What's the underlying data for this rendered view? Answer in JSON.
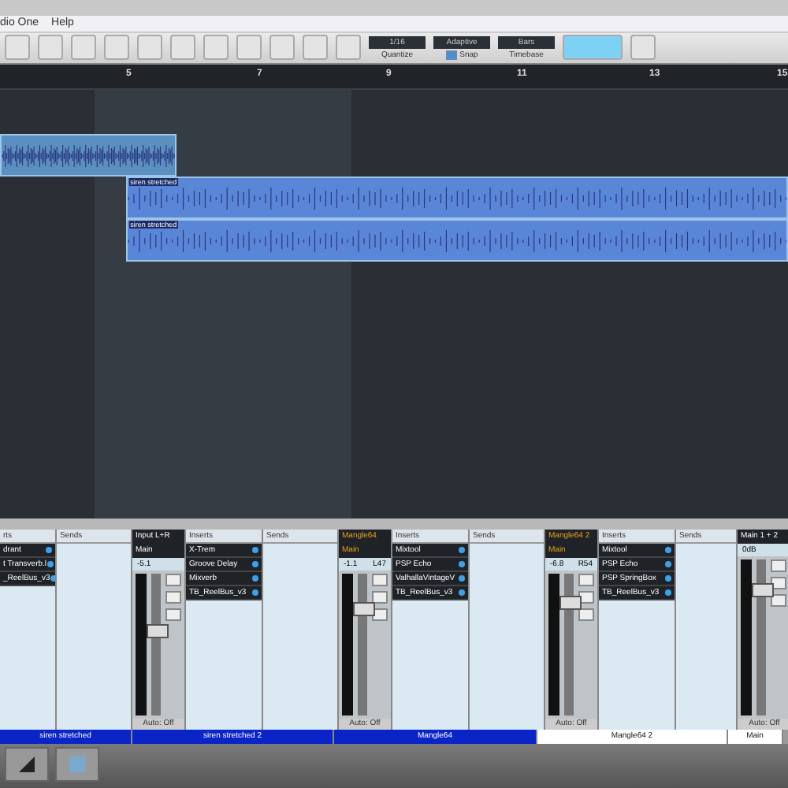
{
  "menu": [
    "dio One",
    "Help"
  ],
  "toolbar": {
    "quantize": {
      "value": "1/16",
      "label": "Quantize"
    },
    "snap": {
      "value": "Adaptive",
      "label": "Snap",
      "checked": true
    },
    "timebase": {
      "value": "Bars",
      "label": "Timebase"
    }
  },
  "ruler": [
    "5",
    "7",
    "9",
    "11",
    "13",
    "15"
  ],
  "clips": [
    {
      "kind": "plain"
    },
    {
      "label": "siren stretched",
      "kind": "blue"
    },
    {
      "label": "siren stretched",
      "kind": "blue"
    }
  ],
  "mixer": [
    {
      "kind": "inserts",
      "title": "rts",
      "items": [
        "drant",
        "t Transverb.l",
        "_ReelBus_v3"
      ]
    },
    {
      "kind": "sends",
      "title": "Sends"
    },
    {
      "kind": "channel",
      "name": "Input L+R",
      "output": "Main",
      "volume": "-5.1",
      "level": 0.55,
      "orange": false,
      "auto": "Auto: Off"
    },
    {
      "kind": "inserts",
      "title": "Inserts",
      "items": [
        "X-Trem",
        "Groove Delay",
        "Mixverb",
        "TB_ReelBus_v3"
      ]
    },
    {
      "kind": "sends",
      "title": "Sends"
    },
    {
      "kind": "channel",
      "name": "Mangle64",
      "output": "Main",
      "volume": "-1.1",
      "pan": "L47",
      "level": 0.75,
      "orange": true,
      "auto": "Auto: Off"
    },
    {
      "kind": "inserts",
      "title": "Inserts",
      "items": [
        "Mixtool",
        "PSP Echo",
        "ValhallaVintageV",
        "TB_ReelBus_v3"
      ]
    },
    {
      "kind": "sends",
      "title": "Sends"
    },
    {
      "kind": "channel",
      "name": "Mangle64 2",
      "output": "Main",
      "volume": "-6.8",
      "pan": "R54",
      "level": 0.8,
      "orange": true,
      "auto": "Auto: Off"
    },
    {
      "kind": "inserts",
      "title": "Inserts",
      "items": [
        "Mixtool",
        "PSP Echo",
        "PSP SpringBox",
        "TB_ReelBus_v3"
      ]
    },
    {
      "kind": "sends",
      "title": "Sends"
    },
    {
      "kind": "main",
      "name": "Main 1 + 2",
      "volume": "0dB",
      "level": 0.8,
      "auto": "Auto: Off"
    }
  ],
  "names": [
    {
      "label": "siren stretched",
      "selected": true
    },
    {
      "label": "siren stretched 2",
      "selected": true
    },
    {
      "label": "Mangle64",
      "selected": true
    },
    {
      "label": "Mangle64 2",
      "selected": false
    },
    {
      "label": "Main",
      "selected": false
    }
  ]
}
